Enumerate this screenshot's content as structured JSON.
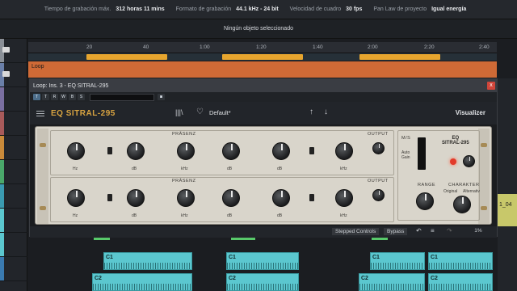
{
  "status_bar": {
    "items": [
      {
        "key": "Tiempo de grabación máx.",
        "value": "312 horas 11 mins"
      },
      {
        "key": "Formato de grabación",
        "value": "44.1 kHz - 24 bit"
      },
      {
        "key": "Velocidad de cuadro",
        "value": "30 fps"
      },
      {
        "key": "Pan Law de proyecto",
        "value": "Igual energía"
      }
    ]
  },
  "info_bar": {
    "text": "Ningún objeto seleccionado"
  },
  "ruler": {
    "ticks": [
      "20",
      "40",
      "1:00",
      "1:20",
      "1:40",
      "2:00",
      "2:20",
      "2:40"
    ]
  },
  "loop_track": {
    "label": "Loop"
  },
  "plugin": {
    "window_title": "Loop: Ins. 3 - EQ SITRAL-295",
    "close_label": "x",
    "toolbar_buttons": [
      "T",
      "T",
      "R",
      "W",
      "B",
      "S"
    ],
    "name": "EQ SITRAL-295",
    "preset": "Default*",
    "visualizer_label": "Visualizer",
    "faceplate": {
      "section_present": "PRÄSENZ",
      "output_label": "OUTPUT",
      "brand_line1": "EQ",
      "brand_line2": "SITRAL-295",
      "ms_label": "M/S",
      "auto_gain_label": "Auto Gain",
      "range_label": "RANGE",
      "character_label": "CHARAKTER",
      "character_left": "Original",
      "character_right": "Alternativ",
      "unit_hz": "Hz",
      "unit_db": "dB",
      "unit_khz": "kHz"
    },
    "bottom": {
      "stepped_controls": "Stepped Controls",
      "bypass": "Bypass",
      "percent": "1%"
    }
  },
  "clips": [
    {
      "name": "C1"
    },
    {
      "name": "C1"
    },
    {
      "name": "C1"
    },
    {
      "name": "C1"
    },
    {
      "name": "C2"
    },
    {
      "name": "C2"
    },
    {
      "name": "C2"
    },
    {
      "name": "C2"
    }
  ],
  "right_clip": {
    "label": "1_04"
  },
  "colors": {
    "accent": "#d9a441",
    "loop_orange": "#cf6a36",
    "clip_cyan": "#5bc7cf"
  }
}
